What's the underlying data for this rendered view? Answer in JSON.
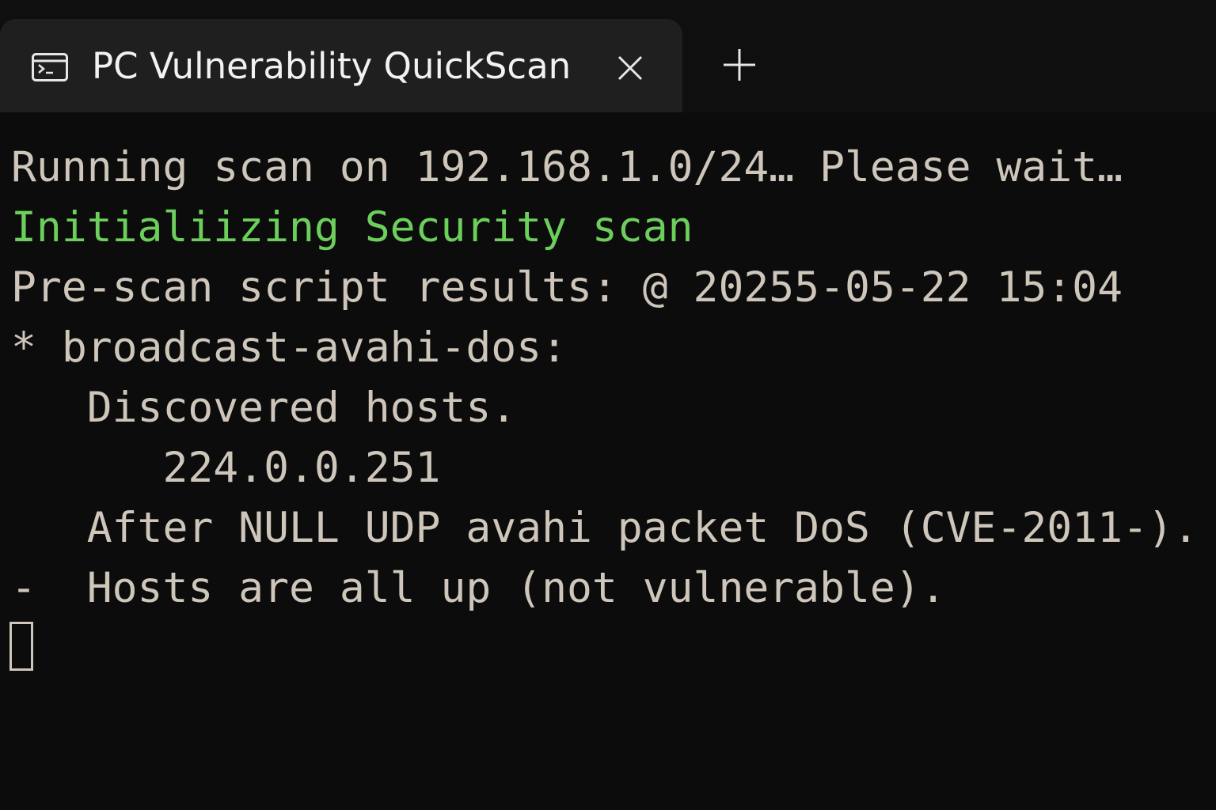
{
  "window": {
    "tab": {
      "title": "PC Vulnerability QuickScan",
      "icon": "terminal-icon",
      "close_icon": "close-icon"
    },
    "new_tab_icon": "plus-icon"
  },
  "terminal": {
    "colors": {
      "background": "#0c0c0c",
      "text": "#cfc6bb",
      "highlight": "#6ccf5c"
    },
    "lines": [
      "Running scan on 192.168.1.0/24… Please wait…",
      "Initialiizing Security scan",
      "Pre-scan script results: @ 20255-05-22 15:04",
      "* broadcast-avahi-dos:",
      "   Discovered hosts.",
      "      224.0.0.251",
      "   After NULL UDP avahi packet DoS (CVE-2011-).",
      "-  Hosts are all up (not vulnerable)."
    ]
  }
}
